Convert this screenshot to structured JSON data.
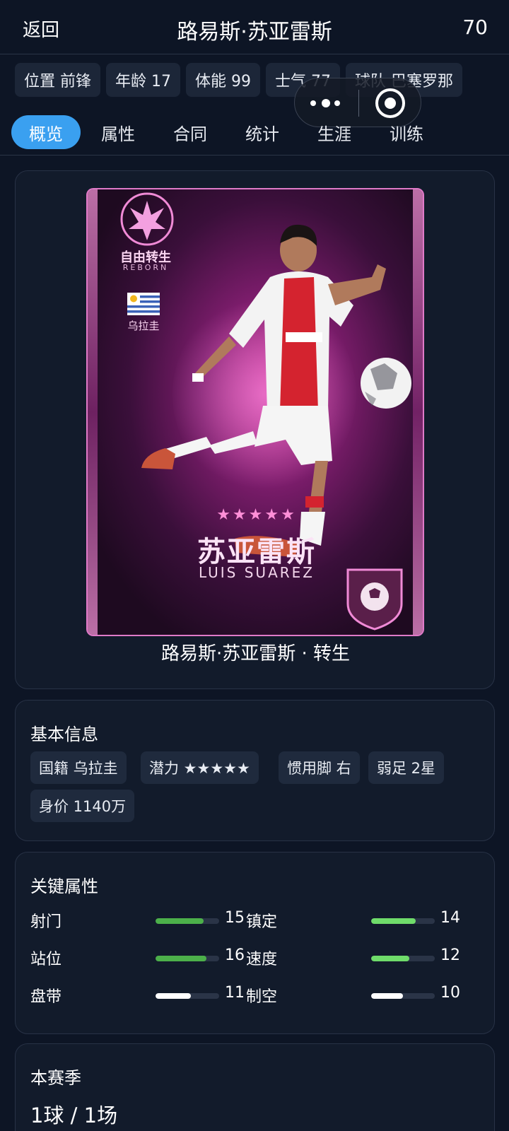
{
  "header": {
    "back_label": "返回",
    "title": "路易斯·苏亚雷斯",
    "rating": "70"
  },
  "chips": [
    {
      "label": "位置 前锋"
    },
    {
      "label": "年龄 17"
    },
    {
      "label": "体能 99"
    },
    {
      "label": "士气 77"
    },
    {
      "label": "球队 巴塞罗那"
    }
  ],
  "tabs": [
    {
      "label": "概览",
      "active": true
    },
    {
      "label": "属性"
    },
    {
      "label": "合同"
    },
    {
      "label": "统计"
    },
    {
      "label": "生涯"
    },
    {
      "label": "训练"
    }
  ],
  "card": {
    "reborn_cn": "自由转生",
    "reborn_en": "REBORN",
    "nation": "乌拉圭",
    "stars": "★★★★★",
    "name_cn": "苏亚雷斯",
    "name_en": "LUIS SUAREZ",
    "caption": "路易斯·苏亚雷斯 · 转生"
  },
  "basic_info": {
    "title": "基本信息",
    "tags": [
      "国籍 乌拉圭",
      "潜力 ★★★★★",
      "惯用脚 右",
      "弱足 2星",
      "身价 1140万"
    ]
  },
  "key_attributes": {
    "title": "关键属性",
    "rows": [
      {
        "left_label": "射门",
        "left_value": "15",
        "left_level": 0.75,
        "left_color": "#4cb04a",
        "right_label": "镇定",
        "right_value": "14",
        "right_level": 0.7,
        "right_color": "#6fdc6a"
      },
      {
        "left_label": "站位",
        "left_value": "16",
        "left_level": 0.8,
        "left_color": "#4cb04a",
        "right_label": "速度",
        "right_value": "12",
        "right_level": 0.6,
        "right_color": "#6fdc6a"
      },
      {
        "left_label": "盘带",
        "left_value": "11",
        "left_level": 0.55,
        "left_color": "#ffffff",
        "right_label": "制空",
        "right_value": "10",
        "right_level": 0.5,
        "right_color": "#ffffff"
      }
    ]
  },
  "season": {
    "title": "本赛季",
    "stat": "1球 / 1场"
  },
  "colors": {
    "accent": "#3aa0f0",
    "background": "#0d1525"
  }
}
